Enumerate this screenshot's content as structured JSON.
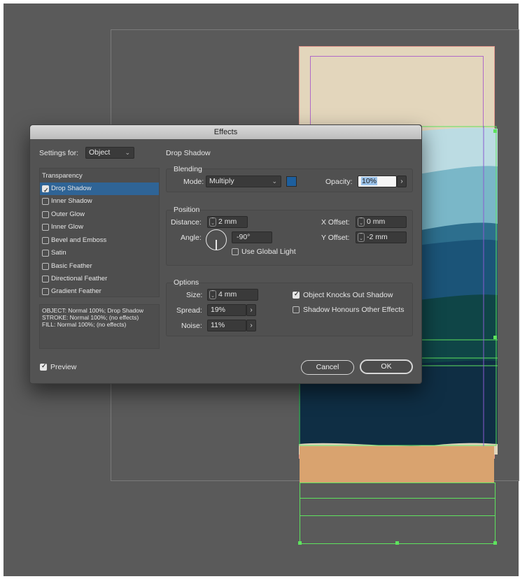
{
  "dialog": {
    "title": "Effects",
    "settings_for_label": "Settings for:",
    "settings_for_value": "Object",
    "section_title": "Drop Shadow",
    "effects_list": {
      "header": "Transparency",
      "items": [
        {
          "label": "Drop Shadow",
          "checked": true,
          "selected": true
        },
        {
          "label": "Inner Shadow",
          "checked": false
        },
        {
          "label": "Outer Glow",
          "checked": false
        },
        {
          "label": "Inner Glow",
          "checked": false
        },
        {
          "label": "Bevel and Emboss",
          "checked": false
        },
        {
          "label": "Satin",
          "checked": false
        },
        {
          "label": "Basic Feather",
          "checked": false
        },
        {
          "label": "Directional Feather",
          "checked": false
        },
        {
          "label": "Gradient Feather",
          "checked": false
        }
      ]
    },
    "summary": [
      "OBJECT: Normal 100%; Drop Shadow",
      "STROKE: Normal 100%; (no effects)",
      "FILL: Normal 100%; (no effects)"
    ],
    "blending": {
      "header": "Blending",
      "mode_label": "Mode:",
      "mode_value": "Multiply",
      "color": "#1d5f9e",
      "opacity_label": "Opacity:",
      "opacity_value": "10%"
    },
    "position": {
      "header": "Position",
      "distance_label": "Distance:",
      "distance_value": "2 mm",
      "angle_label": "Angle:",
      "angle_value": "-90°",
      "global_light_label": "Use Global Light",
      "global_light_checked": false,
      "x_offset_label": "X Offset:",
      "x_offset_value": "0 mm",
      "y_offset_label": "Y Offset:",
      "y_offset_value": "-2 mm"
    },
    "options": {
      "header": "Options",
      "size_label": "Size:",
      "size_value": "4 mm",
      "spread_label": "Spread:",
      "spread_value": "19%",
      "noise_label": "Noise:",
      "noise_value": "11%",
      "knockout_label": "Object Knocks Out Shadow",
      "knockout_checked": true,
      "honours_label": "Shadow Honours Other Effects",
      "honours_checked": false
    },
    "preview_label": "Preview",
    "preview_checked": true,
    "cancel_label": "Cancel",
    "ok_label": "OK"
  },
  "canvas": {
    "colors": {
      "pasteboard": "#5a5a5a",
      "page_fill": "#e3d6bc",
      "selection": "#5ee35e",
      "wave_light": "#bcdce3",
      "wave_mid": "#7ab7c8",
      "wave_teal": "#2d6f8e",
      "wave_blue": "#1b5478",
      "wave_dark_teal": "#0f4547",
      "wave_navy": "#0f2e44",
      "orange_band": "#d9a36f"
    }
  }
}
